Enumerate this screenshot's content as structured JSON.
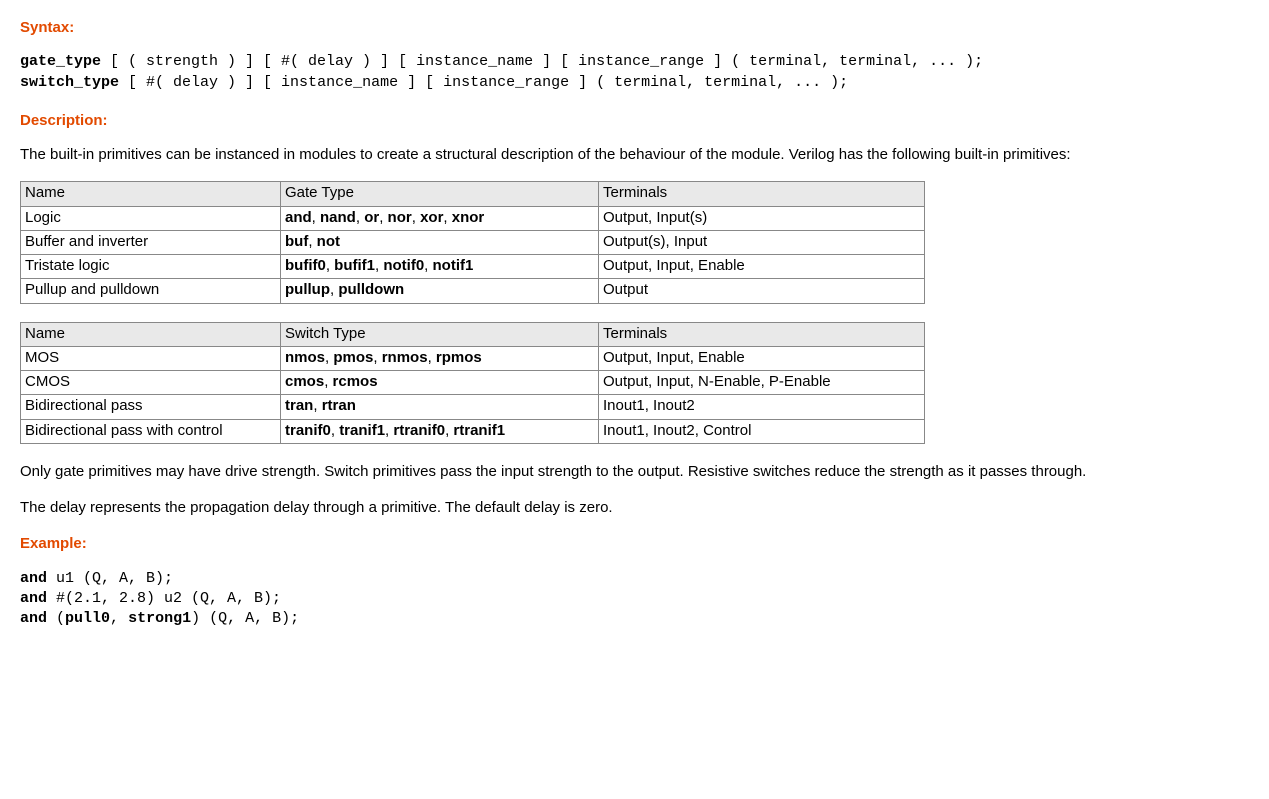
{
  "headings": {
    "syntax": "Syntax:",
    "description": "Description:",
    "example": "Example:"
  },
  "syntax_lines": [
    {
      "kw": "gate_type",
      "rest": " [ ( strength ) ] [ #( delay ) ] [ instance_name ] [ instance_range ] ( terminal, terminal, ... );"
    },
    {
      "kw": "switch_type",
      "rest": " [ #( delay ) ] [ instance_name ] [ instance_range ] ( terminal, terminal, ... );"
    }
  ],
  "desc_intro": "The built-in primitives can be instanced in modules to create a structural description of the behaviour of the module. Verilog has the following built-in primitives:",
  "table1": {
    "headers": [
      "Name",
      "Gate Type",
      "Terminals"
    ],
    "rows": [
      {
        "name": "Logic",
        "types": [
          "and",
          "nand",
          "or",
          "nor",
          "xor",
          "xnor"
        ],
        "terminals": "Output, Input(s)"
      },
      {
        "name": "Buffer and inverter",
        "types": [
          "buf",
          "not"
        ],
        "terminals": "Output(s), Input"
      },
      {
        "name": "Tristate logic",
        "types": [
          "bufif0",
          "bufif1",
          "notif0",
          "notif1"
        ],
        "terminals": "Output, Input, Enable"
      },
      {
        "name": "Pullup and pulldown",
        "types": [
          "pullup",
          "pulldown"
        ],
        "terminals": "Output"
      }
    ]
  },
  "table2": {
    "headers": [
      "Name",
      "Switch Type",
      "Terminals"
    ],
    "rows": [
      {
        "name": "MOS",
        "types": [
          "nmos",
          "pmos",
          "rnmos",
          "rpmos"
        ],
        "terminals": "Output, Input, Enable"
      },
      {
        "name": "CMOS",
        "types": [
          "cmos",
          "rcmos"
        ],
        "terminals": "Output, Input, N-Enable, P-Enable"
      },
      {
        "name": "Bidirectional pass",
        "types": [
          "tran",
          "rtran"
        ],
        "terminals": "Inout1, Inout2"
      },
      {
        "name": "Bidirectional pass with control",
        "types": [
          "tranif0",
          "tranif1",
          "rtranif0",
          "rtranif1"
        ],
        "terminals": "Inout1, Inout2, Control"
      }
    ]
  },
  "desc_p1": "Only gate primitives may have drive strength. Switch primitives pass the input strength to the output. Resistive switches reduce the strength as it passes through.",
  "desc_p2": "The delay represents the propagation delay through a primitive. The default delay is zero.",
  "example_lines": [
    {
      "kw": "and",
      "rest": " u1 (Q, A, B);"
    },
    {
      "kw": "and",
      "rest": " #(2.1, 2.8) u2 (Q, A, B);"
    },
    {
      "kw": "and",
      "rest": " (",
      "kw2": "pull0",
      "mid": ", ",
      "kw3": "strong1",
      "rest2": ") (Q, A, B);"
    }
  ]
}
